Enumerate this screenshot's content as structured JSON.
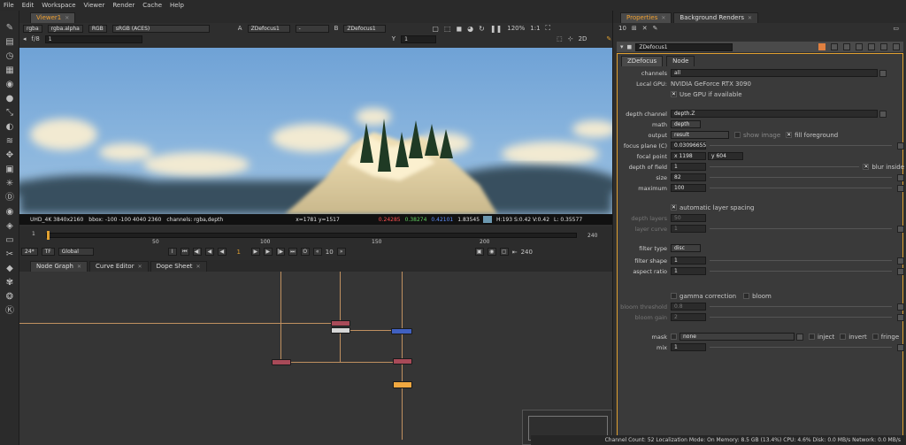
{
  "menu": [
    "File",
    "Edit",
    "Workspace",
    "Viewer",
    "Render",
    "Cache",
    "Help"
  ],
  "viewer": {
    "tab_label": "Viewer1",
    "channels": "rgba",
    "alpha": "rgba.alpha",
    "colorspace_rgb": "RGB",
    "display": "sRGB (ACES)",
    "input_a_label": "A",
    "input_a": "ZDefocus1",
    "input_a_op": "-",
    "input_b_label": "B",
    "input_b": "ZDefocus1",
    "zoom": "120%",
    "ratio": "1:1",
    "fstop": "f/8",
    "frame_val": "1",
    "y_label": "Y",
    "y_val": "1",
    "mode_2d": "2D",
    "info_format": "UHD_4K 3840x2160",
    "info_bbox": "bbox: -100 -100 4040 2360",
    "info_channels": "channels: rgba,depth",
    "info_coords": "x=1781 y=1517",
    "info_r": "0.24285",
    "info_g": "0.38274",
    "info_b": "0.42101",
    "info_a": "1.83545",
    "info_hsv": "H:193 S:0.42 V:0.42",
    "info_l": "L: 0.35577"
  },
  "timeline": {
    "start": "1",
    "ticks": [
      "50",
      "100",
      "150",
      "200"
    ],
    "end_frame": "240",
    "end_frame2": "240",
    "fps": "24*",
    "tf": "TF",
    "global": "Global",
    "current_frame": "1",
    "step": "10"
  },
  "nodegraph": {
    "tabs": [
      "Node Graph",
      "Curve Editor",
      "Dope Sheet"
    ]
  },
  "properties": {
    "tabs": [
      "Properties",
      "Background Renders"
    ],
    "count": "10",
    "node_name": "ZDefocus1",
    "subtabs": [
      "ZDefocus",
      "Node"
    ],
    "channels_label": "channels",
    "channels_val": "all",
    "gpu_label": "Local GPU:",
    "gpu_val": "NVIDIA GeForce RTX 3090",
    "use_gpu": "Use GPU if available",
    "depth_channel_label": "depth channel",
    "depth_channel_val": "depth.Z",
    "math_label": "math",
    "math_val": "depth",
    "output_label": "output",
    "output_val": "result",
    "show_image": "show image",
    "fill_foreground": "fill foreground",
    "focus_plane_label": "focus plane (C)",
    "focus_plane_val": "0.03096655",
    "focal_point_label": "focal point",
    "focal_x": "x 1198",
    "focal_y": "y 604",
    "dof_label": "depth of field",
    "dof_val": "1",
    "blur_inside": "blur inside",
    "size_label": "size",
    "size_val": "82",
    "maximum_label": "maximum",
    "maximum_val": "100",
    "auto_layer": "automatic layer spacing",
    "depth_layers_label": "depth layers",
    "depth_layers_val": "50",
    "layer_curve_label": "layer curve",
    "layer_curve_val": "1",
    "filter_type_label": "filter type",
    "filter_type_val": "disc",
    "filter_shape_label": "filter shape",
    "filter_shape_val": "1",
    "aspect_ratio_label": "aspect ratio",
    "aspect_ratio_val": "1",
    "gamma_correction": "gamma correction",
    "bloom": "bloom",
    "bloom_threshold_label": "bloom threshold",
    "bloom_threshold_val": "0.8",
    "bloom_gain_label": "bloom gain",
    "bloom_gain_val": "2",
    "mask_label": "mask",
    "mask_val": "none",
    "inject": "inject",
    "invert": "invert",
    "fringe": "fringe",
    "mix_label": "mix",
    "mix_val": "1"
  },
  "status": "Channel Count: 52  Localization Mode: On  Memory: 8.5 GB (13.4%)  CPU: 4.6%  Disk: 0.0 MB/s  Network: 0.0 MB/s"
}
